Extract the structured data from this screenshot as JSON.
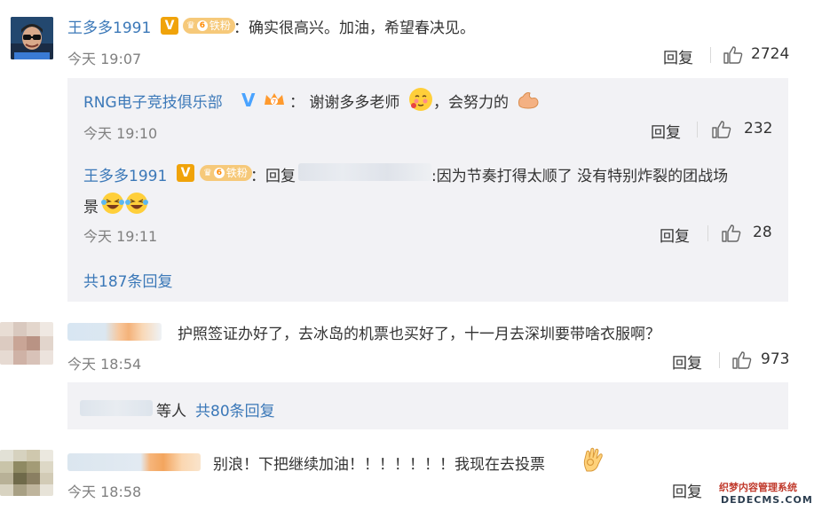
{
  "comments": [
    {
      "user": "王多多1991",
      "text": "：确实很高兴。加油，希望春决见。",
      "time": "今天 19:07",
      "reply_label": "回复",
      "likes": "2724",
      "fan_badge": "铁粉",
      "fan_level": "6",
      "replies": [
        {
          "user": "RNG电子竞技俱乐部",
          "text_a": "：  谢谢多多老师",
          "text_b": "，会努力的",
          "time": "今天 19:10",
          "reply_label": "回复",
          "likes": "232"
        },
        {
          "user": "王多多1991",
          "fan_badge": "铁粉",
          "fan_level": "6",
          "prefix": "：回复",
          "text": ":因为节奏打得太顺了  没有特别炸裂的团战场",
          "text_line2": "景",
          "time": "今天 19:11",
          "reply_label": "回复",
          "likes": "28"
        }
      ],
      "more": "共187条回复"
    },
    {
      "text": "护照签证办好了，去冰岛的机票也买好了，十一月去深圳要带啥衣服啊？",
      "time": "今天 18:54",
      "reply_label": "回复",
      "likes": "973",
      "more_prefix": "等人",
      "more": "共80条回复"
    },
    {
      "text": "别浪！下把继续加油！！！！！！！我现在去投票",
      "time": "今天 18:58",
      "reply_label": "回复"
    }
  ],
  "watermark": {
    "line1": "织梦内容管理系统",
    "line2": "DEDECMS.COM"
  },
  "colors": {
    "name_link": "#3b78b8",
    "panel_bg": "#f2f2f5",
    "text": "#333333",
    "meta": "#808080"
  }
}
